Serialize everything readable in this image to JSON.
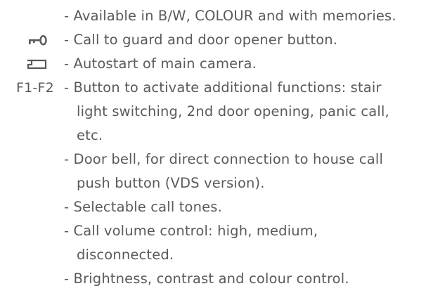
{
  "features": {
    "items": [
      {
        "marker": "",
        "marker_icon": "",
        "lines": [
          "- Available in B/W, COLOUR and with memories."
        ]
      },
      {
        "marker": "",
        "marker_icon": "key-icon",
        "lines": [
          "- Call to guard and door opener button."
        ]
      },
      {
        "marker": "",
        "marker_icon": "camera-icon",
        "lines": [
          "- Autostart of main camera."
        ]
      },
      {
        "marker": "F1-F2",
        "marker_icon": "",
        "lines": [
          "- Button to activate additional functions: stair",
          "light switching, 2nd door opening, panic call,",
          "etc."
        ]
      },
      {
        "marker": "",
        "marker_icon": "",
        "lines": [
          "- Door bell, for direct connection to house call",
          "push button (VDS version)."
        ]
      },
      {
        "marker": "",
        "marker_icon": "",
        "lines": [
          "- Selectable call tones."
        ]
      },
      {
        "marker": "",
        "marker_icon": "",
        "lines": [
          "- Call volume control: high, medium,",
          "disconnected."
        ]
      },
      {
        "marker": "",
        "marker_icon": "",
        "lines": [
          "- Brightness, contrast and colour control."
        ]
      }
    ]
  },
  "colors": {
    "text": "#5a5a5a",
    "background": "#ffffff"
  }
}
